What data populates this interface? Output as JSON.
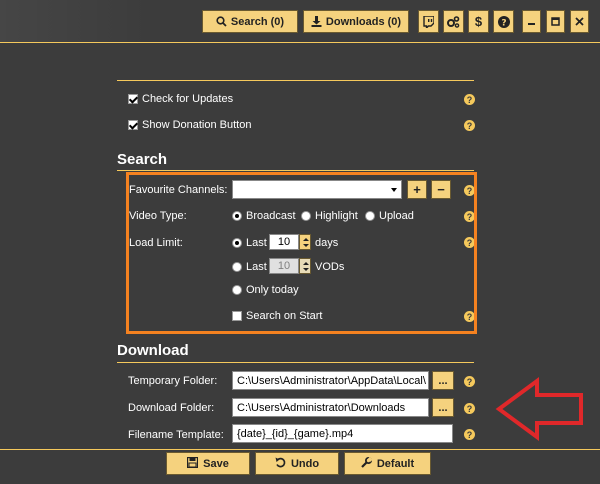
{
  "toolbar": {
    "search_label": "Search (0)",
    "downloads_label": "Downloads (0)",
    "twitch_icon": "twitch-icon",
    "settings_icon": "cogs-icon",
    "donate_icon": "dollar-icon",
    "help_icon": "question-icon",
    "minimize_icon": "minimize-icon",
    "maximize_icon": "maximize-icon",
    "close_icon": "close-icon"
  },
  "general": {
    "check_updates_label": "Check for Updates",
    "check_updates_checked": true,
    "show_donation_label": "Show Donation Button",
    "show_donation_checked": true
  },
  "search": {
    "heading": "Search",
    "favourite_channels_label": "Favourite Channels:",
    "favourite_channels_value": "",
    "add_label": "+",
    "remove_label": "−",
    "video_type_label": "Video Type:",
    "video_types": [
      "Broadcast",
      "Highlight",
      "Upload"
    ],
    "video_type_selected": "Broadcast",
    "load_limit_label": "Load Limit:",
    "last_days_prefix": "Last",
    "last_days_value": "10",
    "last_days_suffix": "days",
    "last_vods_prefix": "Last",
    "last_vods_value": "10",
    "last_vods_suffix": "VODs",
    "only_today_label": "Only today",
    "search_on_start_label": "Search on Start",
    "search_on_start_checked": false
  },
  "download": {
    "heading": "Download",
    "temp_folder_label": "Temporary Folder:",
    "temp_folder_value": "C:\\Users\\Administrator\\AppData\\Local\\",
    "download_folder_label": "Download Folder:",
    "download_folder_value": "C:\\Users\\Administrator\\Downloads",
    "filename_template_label": "Filename Template:",
    "filename_template_value": "{date}_{id}_{game}.mp4",
    "browse_label": "..."
  },
  "help_glyph": "?",
  "footer": {
    "save_label": "Save",
    "undo_label": "Undo",
    "default_label": "Default"
  },
  "colors": {
    "background": "#3c3c3c",
    "accent": "#f5c95c",
    "button": "#f5d27e",
    "highlight_box": "#f58220",
    "arrow": "#e0282a"
  }
}
